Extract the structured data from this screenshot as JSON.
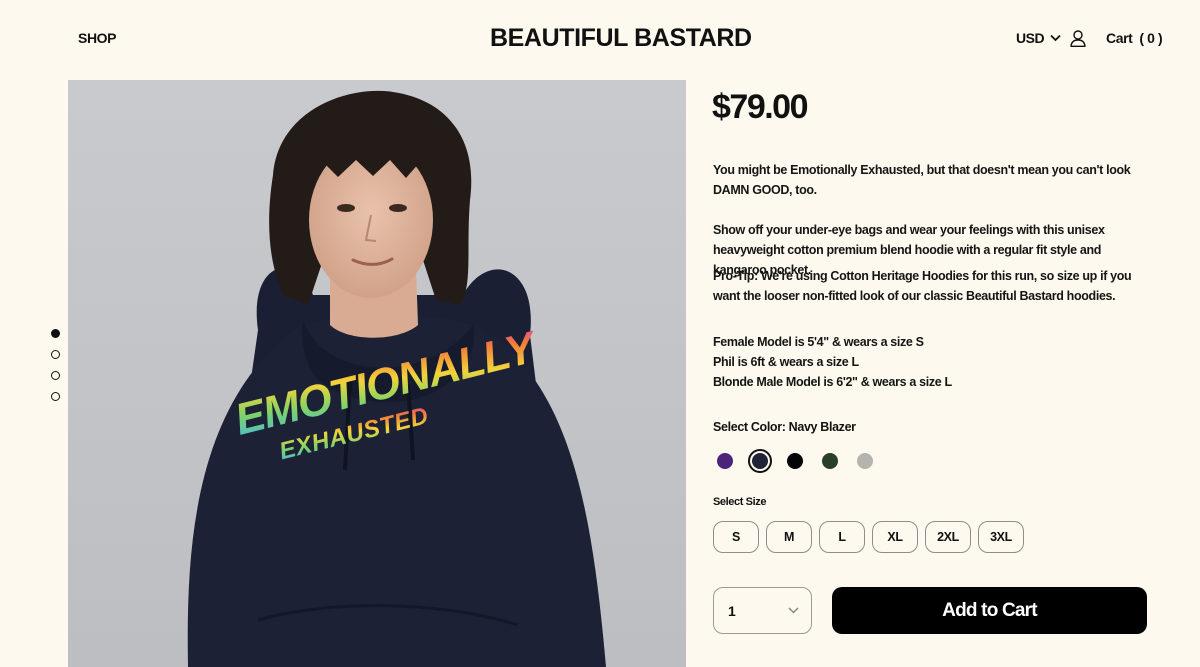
{
  "header": {
    "shop_label": "SHOP",
    "logo": "BEAUTIFUL BASTARD",
    "currency": "USD",
    "cart_label": "Cart",
    "cart_count": "( 0 )"
  },
  "gallery": {
    "slide_count": 4,
    "active_slide": 1,
    "print_line1": "EMOTIONALLY",
    "print_line2": "EXHAUSTED"
  },
  "product": {
    "price": "$79.00",
    "description": [
      "You might be Emotionally Exhausted, but that doesn't mean you can't look DAMN GOOD, too.",
      "Show off your under-eye bags and wear your feelings with this unisex heavyweight cotton premium blend hoodie with a regular fit style and kangaroo pocket.",
      "Pro-Tip: We're using Cotton Heritage Hoodies for this run, so size up if you want the looser non-fitted look of our classic Beautiful Bastard hoodies."
    ],
    "model_info": [
      "Female Model is 5'4\" & wears a size S",
      "Phil is 6ft & wears a size L",
      "Blonde Male Model is 6'2\" & wears a size L"
    ],
    "color_label": "Select Color: Navy Blazer",
    "colors": [
      {
        "name": "purple",
        "hex": "#4b2577",
        "selected": false
      },
      {
        "name": "navy-blazer",
        "hex": "#1f2438",
        "selected": true
      },
      {
        "name": "black",
        "hex": "#050505",
        "selected": false
      },
      {
        "name": "forest-green",
        "hex": "#2a3f27",
        "selected": false
      },
      {
        "name": "heather-grey",
        "hex": "#b5b3ad",
        "selected": false
      }
    ],
    "size_label": "Select Size",
    "sizes": [
      "S",
      "M",
      "L",
      "XL",
      "2XL",
      "3XL"
    ],
    "quantity": "1",
    "add_to_cart": "Add to Cart"
  }
}
